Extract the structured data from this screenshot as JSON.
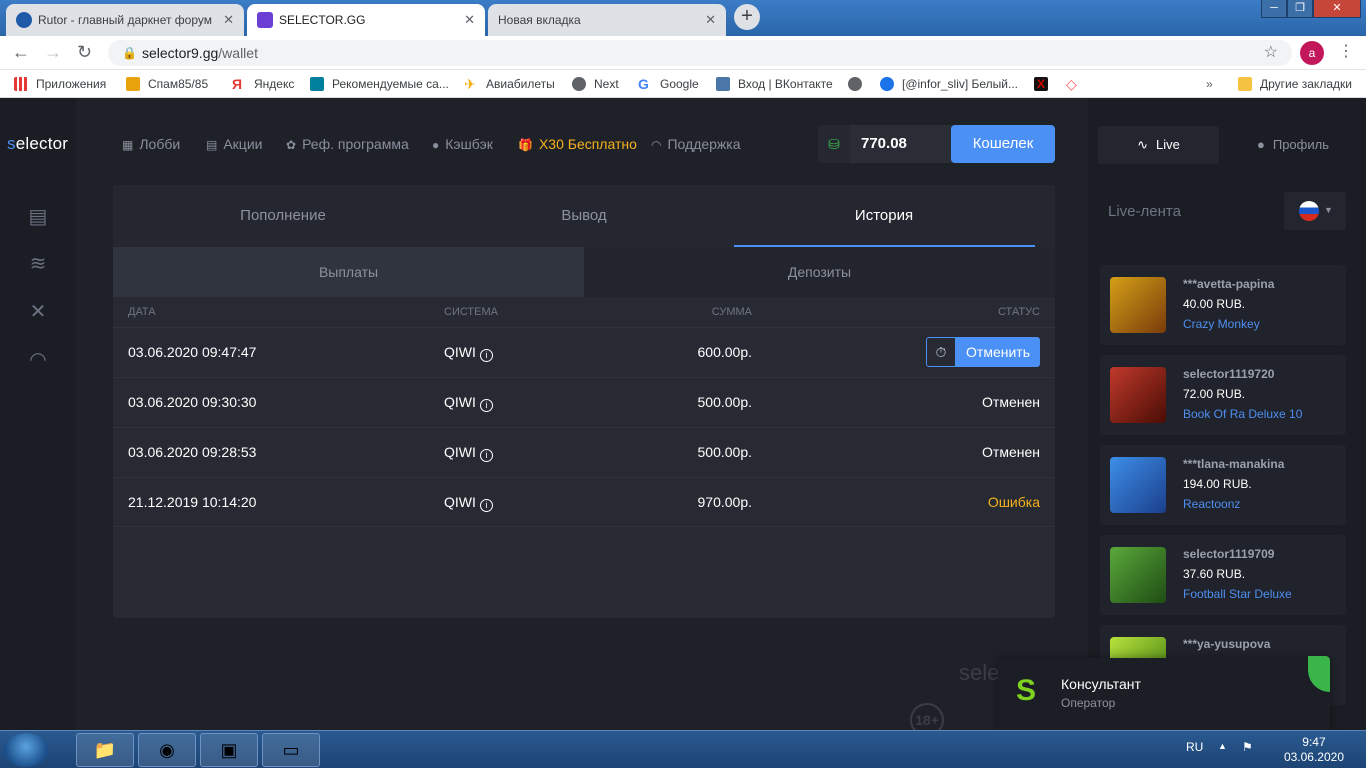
{
  "browser": {
    "tabs": [
      {
        "title": "Rutor - главный даркнет форум"
      },
      {
        "title": "SELECTOR.GG"
      },
      {
        "title": "Новая вкладка"
      }
    ],
    "url_host": "selector9.gg",
    "url_path": "/wallet",
    "avatar_letter": "a"
  },
  "bookmarks": [
    {
      "label": "Приложения",
      "icon": "apps-grid-icon",
      "color": "#e53935"
    },
    {
      "label": "Спам85/85",
      "icon": "mail-icon",
      "color": "#e8a20c"
    },
    {
      "label": "Яндекс",
      "icon": "yandex-icon",
      "color": "#e53935"
    },
    {
      "label": "Рекомендуемые са...",
      "icon": "bing-icon",
      "color": "#00809d"
    },
    {
      "label": "Авиабилеты",
      "icon": "plane-icon",
      "color": "#f2a900"
    },
    {
      "label": "Next",
      "icon": "globe-icon",
      "color": "#5f6368"
    },
    {
      "label": "Google",
      "icon": "google-icon",
      "color": "#4285f4"
    },
    {
      "label": "Вход | ВКонтакте",
      "icon": "vk-icon",
      "color": "#4a76a8"
    },
    {
      "label": "",
      "icon": "globe-icon",
      "color": "#5f6368"
    },
    {
      "label": "[@infor_sliv] Белый...",
      "icon": "edge-icon",
      "color": "#1a73e8"
    },
    {
      "label": "",
      "icon": "x-icon",
      "color": "#d50000"
    },
    {
      "label": "",
      "icon": "airbnb-icon",
      "color": "#ff5a5f"
    }
  ],
  "other_bookmarks": "Другие закладки",
  "site": {
    "logo_prefix": "s",
    "logo_rest": "elector",
    "nav": [
      "Лобби",
      "Акции",
      "Реф. программа",
      "Кэшбэк",
      "Х30 Бесплатно",
      "Поддержка"
    ],
    "balance": "770.08",
    "wallet_button": "Кошелек"
  },
  "wallet": {
    "tabs": [
      "Пополнение",
      "Вывод",
      "История"
    ],
    "subtabs": [
      "Выплаты",
      "Депозиты"
    ],
    "columns": [
      "Дата",
      "Система",
      "Сумма",
      "Статус"
    ],
    "rows": [
      {
        "date": "03.06.2020 09:47:47",
        "system": "QIWI",
        "amount": "600.00р.",
        "status": "",
        "action": "Отменить"
      },
      {
        "date": "03.06.2020 09:30:30",
        "system": "QIWI",
        "amount": "500.00р.",
        "status": "Отменен"
      },
      {
        "date": "03.06.2020 09:28:53",
        "system": "QIWI",
        "amount": "500.00р.",
        "status": "Отменен"
      },
      {
        "date": "21.12.2019 10:14:20",
        "system": "QIWI",
        "amount": "970.00р.",
        "status": "Ошибка"
      }
    ]
  },
  "sidebar": {
    "live": "Live",
    "profile": "Профиль",
    "feed_title": "Live-лента",
    "feed": [
      {
        "user": "***avetta-papina",
        "amount": "40.00 RUB.",
        "game": "Crazy Monkey",
        "color": "#d4a017"
      },
      {
        "user": "selector1119720",
        "amount": "72.00 RUB.",
        "game": "Book Of Ra Deluxe 10",
        "color": "#8b1e10"
      },
      {
        "user": "***tlana-manakina",
        "amount": "194.00 RUB.",
        "game": "Reactoonz",
        "color": "#2a6fd1"
      },
      {
        "user": "selector1119709",
        "amount": "37.60 RUB.",
        "game": "Football Star Deluxe",
        "color": "#3f8a2a"
      },
      {
        "user": "***ya-yusupova",
        "amount": "",
        "game": "",
        "color": "#9bd12c"
      }
    ]
  },
  "consultant": {
    "title": "Консультант",
    "subtitle": "Оператор"
  },
  "footer": {
    "logo": "sele",
    "age": "18+"
  },
  "taskbar": {
    "lang": "RU",
    "time": "9:47",
    "date": "03.06.2020"
  }
}
